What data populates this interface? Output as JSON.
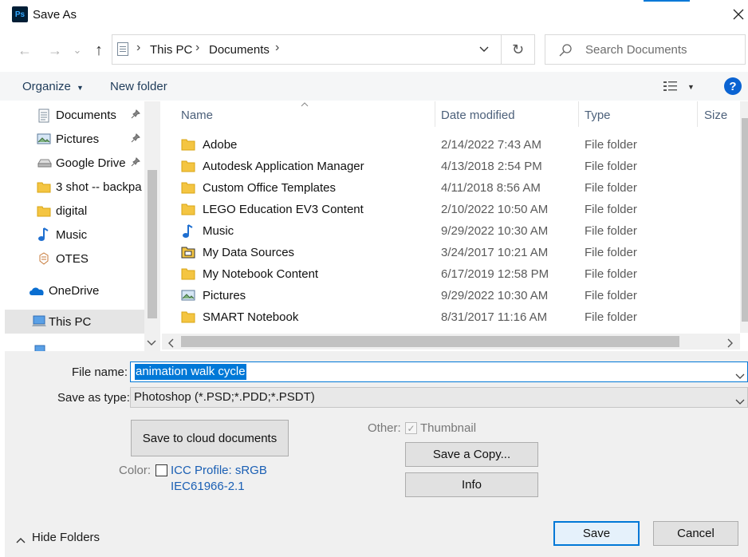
{
  "window": {
    "title": "Save As",
    "app_logo": "Ps"
  },
  "nav": {
    "back": "←",
    "forward": "→",
    "recent": "⌄",
    "up": "↑",
    "breadcrumb": [
      "This PC",
      "Documents"
    ],
    "sep": "›",
    "refresh": "↻",
    "search_placeholder": "Search Documents"
  },
  "toolbar": {
    "organize": "Organize",
    "new_folder": "New folder",
    "help": "?"
  },
  "sidebar": {
    "items": [
      {
        "label": "Documents",
        "icon": "documents-icon",
        "pinned": true
      },
      {
        "label": "Pictures",
        "icon": "pictures-icon",
        "pinned": true
      },
      {
        "label": "Google Drive",
        "icon": "drive-icon",
        "pinned": true
      },
      {
        "label": "3 shot -- backpa",
        "icon": "folder-icon",
        "pinned": false
      },
      {
        "label": "digital",
        "icon": "folder-icon",
        "pinned": false
      },
      {
        "label": "Music",
        "icon": "music-icon",
        "pinned": false
      },
      {
        "label": "OTES",
        "icon": "otes-icon",
        "pinned": false
      },
      {
        "label": "OneDrive",
        "icon": "onedrive-icon",
        "pinned": false
      },
      {
        "label": "This PC",
        "icon": "thispc-icon",
        "pinned": false,
        "selected": true
      }
    ],
    "pin_glyph": "📌"
  },
  "columns": {
    "name": "Name",
    "date": "Date modified",
    "type": "Type",
    "size": "Size"
  },
  "files": [
    {
      "name": "Adobe",
      "date": "2/14/2022 7:43 AM",
      "type": "File folder",
      "icon": "folder-icon"
    },
    {
      "name": "Autodesk Application Manager",
      "date": "4/13/2018 2:54 PM",
      "type": "File folder",
      "icon": "folder-icon"
    },
    {
      "name": "Custom Office Templates",
      "date": "4/11/2018 8:56 AM",
      "type": "File folder",
      "icon": "folder-icon"
    },
    {
      "name": "LEGO Education EV3 Content",
      "date": "2/10/2022 10:50 AM",
      "type": "File folder",
      "icon": "folder-icon"
    },
    {
      "name": "Music",
      "date": "9/29/2022 10:30 AM",
      "type": "File folder",
      "icon": "music-icon"
    },
    {
      "name": "My Data Sources",
      "date": "3/24/2017 10:21 AM",
      "type": "File folder",
      "icon": "datasource-icon"
    },
    {
      "name": "My Notebook Content",
      "date": "6/17/2019 12:58 PM",
      "type": "File folder",
      "icon": "folder-icon"
    },
    {
      "name": "Pictures",
      "date": "9/29/2022 10:30 AM",
      "type": "File folder",
      "icon": "pictures-icon"
    },
    {
      "name": "SMART Notebook",
      "date": "8/31/2017 11:16 AM",
      "type": "File folder",
      "icon": "folder-icon"
    }
  ],
  "form": {
    "file_name_label": "File name:",
    "file_name_value": "animation walk cycle",
    "save_type_label": "Save as type:",
    "save_type_value": "Photoshop (*.PSD;*.PDD;*.PSDT)",
    "cloud_button": "Save to cloud documents",
    "other_label": "Other:",
    "thumbnail_label": "Thumbnail",
    "save_copy_button": "Save a Copy...",
    "info_button": "Info",
    "color_label": "Color:",
    "icc_line1": "ICC Profile:  sRGB",
    "icc_line2": "IEC61966-2.1",
    "hide_folders": "Hide Folders",
    "save_button": "Save",
    "cancel_button": "Cancel"
  },
  "colors": {
    "accent": "#0078d7",
    "link": "#1a5fb4",
    "folder": "#f4c542",
    "help": "#0a63d2"
  }
}
